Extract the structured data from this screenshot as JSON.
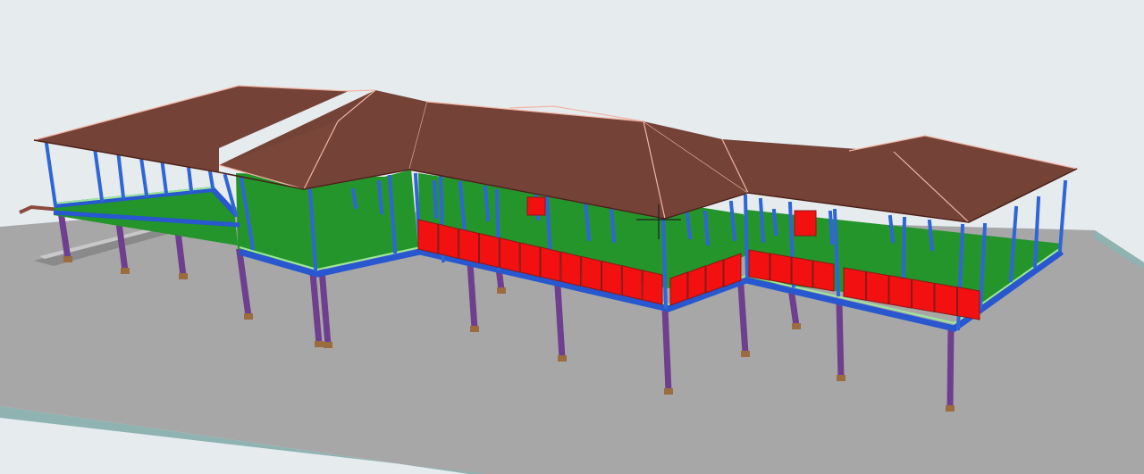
{
  "viewport": {
    "background": "#e6ebee"
  },
  "colors": {
    "ground_top": "#a7a7a7",
    "ground_edge": "#8fb3b1",
    "roof": "#744237",
    "roof_dark": "#623328",
    "roof_ridge": "#f1b5a6",
    "floor": "#23952a",
    "floor_edge": "#9ee79a",
    "beam": "#2857cf",
    "post": "#2f66d6",
    "pier": "#6f3f8f",
    "footing": "#9b6c3e",
    "panel": "#f21010",
    "panel_border": "#8b1818"
  },
  "model": {
    "elements": [
      "ground-plane",
      "roof",
      "floor-slab",
      "perimeter-beam",
      "columns",
      "piers",
      "railing-panels"
    ]
  },
  "cursor": {
    "icon": "crosshair-cursor-icon"
  }
}
